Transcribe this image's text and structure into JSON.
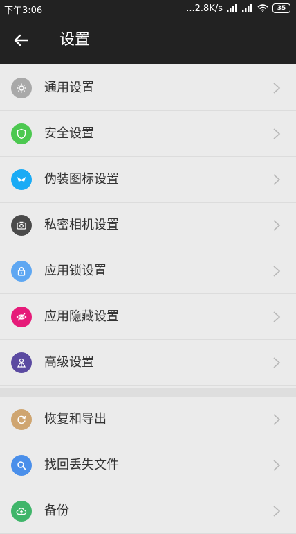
{
  "status_bar": {
    "time": "下午3:06",
    "network_speed": "...2.8K/s",
    "battery": "35"
  },
  "app_bar": {
    "title": "设置",
    "back_icon": "arrow-left-icon"
  },
  "colors": {
    "app_bar_bg": "#222222",
    "list_bg": "#ebebeb",
    "chevron": "#b8b8b8"
  },
  "settings_group_1": [
    {
      "label": "通用设置",
      "icon": "gear-icon",
      "color": "#a9a9a9"
    },
    {
      "label": "安全设置",
      "icon": "shield-icon",
      "color": "#4cc850"
    },
    {
      "label": "伪装图标设置",
      "icon": "bird-icon",
      "color": "#1aabf5"
    },
    {
      "label": "私密相机设置",
      "icon": "camera-icon",
      "color": "#4a4a4a"
    },
    {
      "label": "应用锁设置",
      "icon": "lock-icon",
      "color": "#5ea7f2"
    },
    {
      "label": "应用隐藏设置",
      "icon": "eye-hidden-icon",
      "color": "#e61b79"
    },
    {
      "label": "高级设置",
      "icon": "user-advanced-icon",
      "color": "#5b4aa1"
    }
  ],
  "settings_group_2": [
    {
      "label": "恢复和导出",
      "icon": "restore-icon",
      "color": "#cfa570"
    },
    {
      "label": "找回丢失文件",
      "icon": "search-file-icon",
      "color": "#4a8fea"
    },
    {
      "label": "备份",
      "icon": "backup-icon",
      "color": "#3fb56a"
    }
  ]
}
